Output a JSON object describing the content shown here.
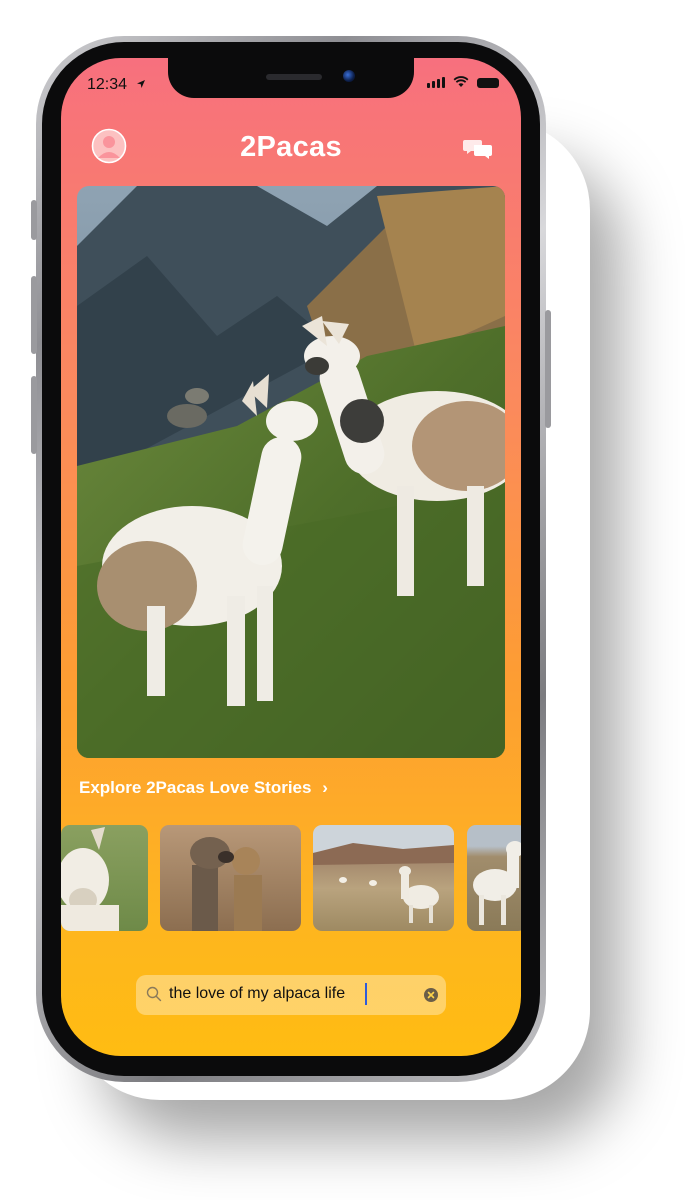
{
  "status_bar": {
    "time": "12:34"
  },
  "header": {
    "title": "2Pacas",
    "profile_icon": "person-circle-icon",
    "chat_icon": "chat-bubbles-icon"
  },
  "hero": {
    "image": "two-llamas-on-mountain-slope"
  },
  "explore": {
    "label": "Explore 2Pacas Love Stories",
    "chevron": "›"
  },
  "thumbnails": [
    "llama-face",
    "two-alpacas-nuzzling",
    "alpacas-in-field",
    "white-alpaca"
  ],
  "search": {
    "value": "the love of my alpaca life",
    "icon": "search-icon",
    "clear_icon": "clear-icon"
  },
  "colors": {
    "gradient_top": "#f7707e",
    "gradient_mid": "#fd9d33",
    "gradient_bottom": "#ffbc12",
    "text_on_gradient": "#ffffff"
  }
}
